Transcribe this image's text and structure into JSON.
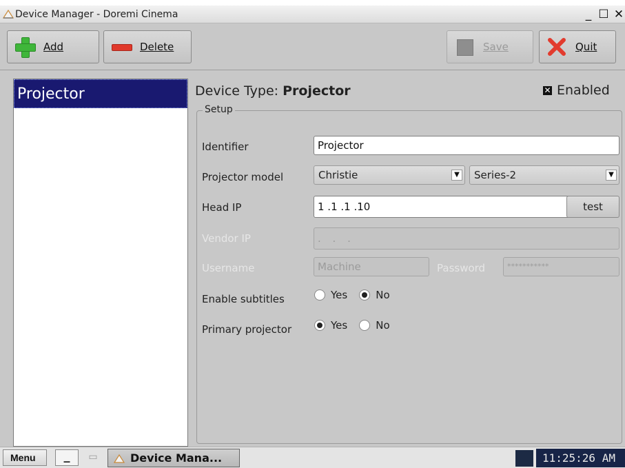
{
  "window": {
    "title": "Device Manager - Doremi Cinema",
    "minimize_glyph": "_",
    "maximize_glyph": "☐",
    "close_glyph": "✕"
  },
  "toolbar": {
    "add_label": "Add",
    "add_icon": "plus-icon",
    "delete_label": "Delete",
    "delete_icon": "minus-icon",
    "save_label": "Save",
    "save_enabled": false,
    "quit_label": "Quit",
    "quit_icon": "x-icon"
  },
  "device_list": {
    "items": [
      {
        "label": "Projector",
        "selected": true
      }
    ]
  },
  "panel": {
    "device_type_prefix": "Device Type: ",
    "device_type_value": "Projector",
    "enabled_label": "Enabled",
    "enabled_checked": true,
    "setup_title": "Setup",
    "identifier": {
      "label": "Identifier",
      "value": "Projector"
    },
    "projector_model": {
      "label": "Projector model",
      "make": "Christie",
      "series": "Series-2"
    },
    "head_ip": {
      "label": "Head IP",
      "value": "1 .1 .1 .10",
      "test_label": "test"
    },
    "vendor_ip": {
      "label": "Vendor IP",
      "value": ". . .",
      "enabled": false
    },
    "username": {
      "label": "Username",
      "value": "Machine",
      "enabled": false
    },
    "password": {
      "label": "Password",
      "value": "***********",
      "enabled": false
    },
    "enable_subtitles": {
      "label": "Enable subtitles",
      "options": [
        "Yes",
        "No"
      ],
      "selected": "No"
    },
    "primary_projector": {
      "label": "Primary projector",
      "options": [
        "Yes",
        "No"
      ],
      "selected": "Yes"
    }
  },
  "taskbar": {
    "menu_label": "Menu",
    "minimize_label": "_",
    "task_label": "Device Mana...",
    "clock": "11:25:26 AM"
  },
  "colors": {
    "selection_bg": "#191970",
    "window_bg": "#c8c8c8",
    "add_green": "#3fb63a",
    "delete_red": "#e0392b",
    "quit_red": "#e23b2e",
    "clock_bg": "#172447"
  }
}
